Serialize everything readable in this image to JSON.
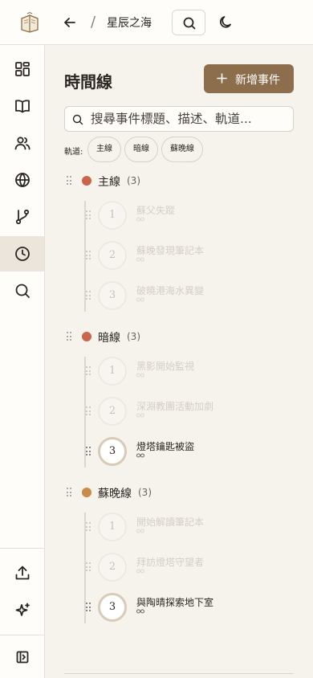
{
  "header": {
    "project_name": "星辰之海",
    "slash": "/",
    "icons": [
      "book-logo-icon",
      "arrow-left-icon",
      "search-icon",
      "moon-icon"
    ]
  },
  "sidebar": {
    "items": [
      {
        "icon": "dashboard-icon"
      },
      {
        "icon": "book-open-icon"
      },
      {
        "icon": "users-icon"
      },
      {
        "icon": "globe-icon"
      },
      {
        "icon": "git-branch-icon"
      },
      {
        "icon": "clock-icon",
        "active": true
      },
      {
        "icon": "search-icon"
      }
    ],
    "bottom_items": [
      {
        "icon": "upload-icon"
      },
      {
        "icon": "sparkles-icon"
      },
      {
        "icon": "sidebar-toggle-icon"
      }
    ]
  },
  "main": {
    "title": "時間線",
    "add_button_label": "新增事件",
    "search_placeholder": "搜尋事件標題、描述、軌道...",
    "filter_label": "軌道:",
    "filter_chips": [
      "主線",
      "暗線",
      "蘇晚線"
    ],
    "groups": [
      {
        "name": "主線",
        "count": "(3)",
        "color": "#c9654b",
        "events": [
          {
            "num": "1",
            "title": "蘇父失蹤",
            "active": false
          },
          {
            "num": "2",
            "title": "蘇晚發現筆記本",
            "active": false
          },
          {
            "num": "3",
            "title": "破曉港海水異變",
            "active": false
          }
        ]
      },
      {
        "name": "暗線",
        "count": "(3)",
        "color": "#c9654b",
        "events": [
          {
            "num": "1",
            "title": "黑影開始監視",
            "active": false
          },
          {
            "num": "2",
            "title": "深淵教團活動加劇",
            "active": false
          },
          {
            "num": "3",
            "title": "燈塔鑰匙被盜",
            "active": true
          }
        ]
      },
      {
        "name": "蘇晚線",
        "count": "(3)",
        "color": "#c98a4b",
        "events": [
          {
            "num": "1",
            "title": "開始解讀筆記本",
            "active": false
          },
          {
            "num": "2",
            "title": "拜訪燈塔守望者",
            "active": false
          },
          {
            "num": "3",
            "title": "與陶晴探索地下室",
            "active": true
          }
        ]
      }
    ]
  },
  "colors": {
    "accent": "#8c6e4c",
    "background": "#f6f2ec",
    "panel": "#fffdfa",
    "active_nav": "#ebe5dc"
  }
}
